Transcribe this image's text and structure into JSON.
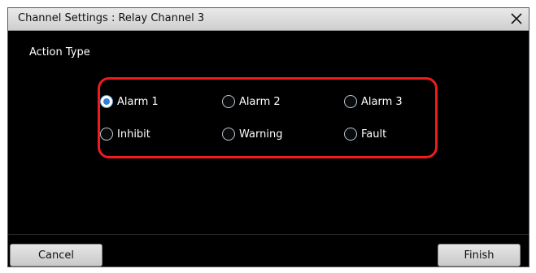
{
  "dialog": {
    "title": "Channel Settings : Relay Channel 3",
    "close_icon": "close-icon"
  },
  "action_type": {
    "label": "Action Type",
    "selected": "Alarm 1",
    "options": [
      "Alarm 1",
      "Alarm 2",
      "Alarm 3",
      "Inhibit",
      "Warning",
      "Fault"
    ]
  },
  "buttons": {
    "cancel": "Cancel",
    "finish": "Finish"
  },
  "colors": {
    "highlight": "#ee1c1c",
    "radio_selected": "#2f7fd8",
    "background": "#000000"
  }
}
